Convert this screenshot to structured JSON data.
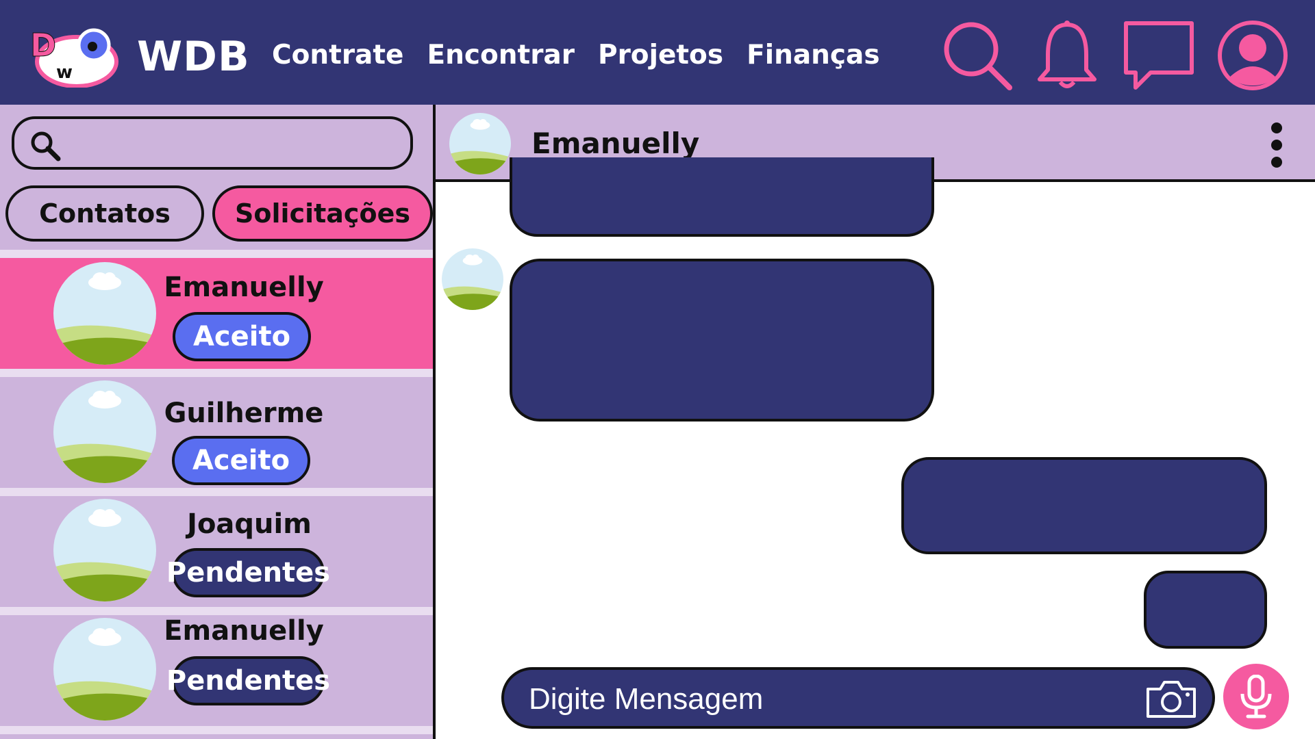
{
  "header": {
    "brand": "WDB",
    "logo_letters": [
      "D",
      "w"
    ],
    "nav": [
      "Contrate",
      "Encontrar",
      "Projetos",
      "Finanças"
    ]
  },
  "sidebar": {
    "search_placeholder": "",
    "tabs": {
      "contacts": "Contatos",
      "requests": "Solicitações",
      "active": "requests"
    },
    "rows": [
      {
        "name": "Emanuelly",
        "status": "Aceito",
        "active": true
      },
      {
        "name": "Guilherme",
        "status": "Aceito",
        "active": false
      },
      {
        "name": "Joaquim",
        "status": "Pendentes",
        "active": false
      },
      {
        "name": "Emanuelly",
        "status": "Pendentes",
        "active": false
      }
    ]
  },
  "chat": {
    "title": "Emanuelly",
    "composer_placeholder": "Digite Mensagem"
  },
  "colors": {
    "navy": "#323574",
    "pink": "#f55aa0",
    "lavender": "#cdb4dc",
    "badge_accepted": "#5a6ef0"
  },
  "icons": [
    "search-icon",
    "bell-icon",
    "chat-icon",
    "profile-icon",
    "more-vertical-icon",
    "camera-icon",
    "microphone-icon"
  ]
}
